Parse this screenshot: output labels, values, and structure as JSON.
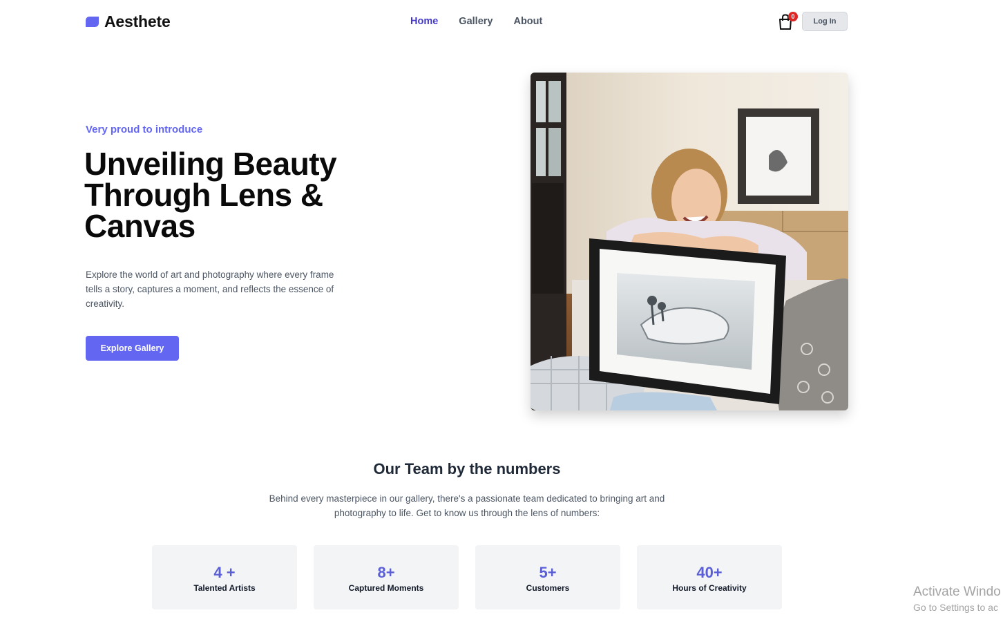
{
  "header": {
    "brand": "Aesthete",
    "nav": [
      {
        "label": "Home",
        "active": true
      },
      {
        "label": "Gallery",
        "active": false
      },
      {
        "label": "About",
        "active": false
      }
    ],
    "cart_count": "0",
    "login_label": "Log In"
  },
  "hero": {
    "eyebrow": "Very proud to introduce",
    "title": "Unveiling Beauty Through Lens & Canvas",
    "description": "Explore the world of art and photography where every frame tells a story, captures a moment, and reflects the essence of creativity.",
    "cta_label": "Explore Gallery"
  },
  "team": {
    "title": "Our Team by the numbers",
    "description": "Behind every masterpiece in our gallery, there's a passionate team dedicated to bringing art and photography to life. Get to know us through the lens of numbers:",
    "stats": [
      {
        "value": "4 +",
        "label": "Talented Artists"
      },
      {
        "value": "8+",
        "label": "Captured Moments"
      },
      {
        "value": "5+",
        "label": "Customers"
      },
      {
        "value": "40+",
        "label": "Hours of Creativity"
      }
    ]
  },
  "watermark": {
    "title": "Activate Windo",
    "subtitle": "Go to Settings to ac"
  },
  "colors": {
    "accent": "#6366f1",
    "nav_active": "#4338ca",
    "badge": "#dc2626"
  }
}
